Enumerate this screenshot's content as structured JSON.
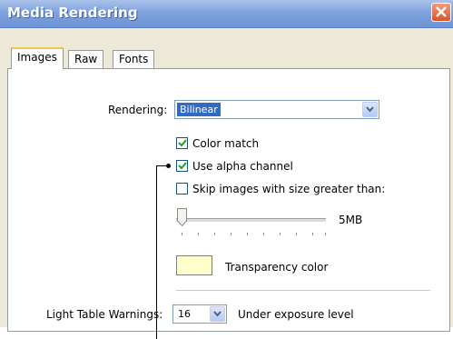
{
  "window": {
    "title": "Media Rendering"
  },
  "tabs": [
    {
      "label": "Images",
      "active": true
    },
    {
      "label": "Raw",
      "active": false
    },
    {
      "label": "Fonts",
      "active": false
    }
  ],
  "images": {
    "rendering_label": "Rendering:",
    "rendering_value": "Bilinear",
    "color_match_label": "Color match",
    "color_match_checked": true,
    "alpha_label": "Use alpha channel",
    "alpha_checked": true,
    "skip_label": "Skip images with size greater than:",
    "skip_checked": false,
    "slider_value_label": "5MB",
    "slider_position": 0.05,
    "transparency_label": "Transparency color",
    "transparency_color": "#ffffcc",
    "light_table_label": "Light Table Warnings:",
    "light_table_value": "16",
    "exposure_label": "Under exposure level"
  },
  "colors": {
    "titlebar": "#7fa2dd",
    "active_tab_accent": "#f7c34b",
    "check": "#21a121"
  }
}
